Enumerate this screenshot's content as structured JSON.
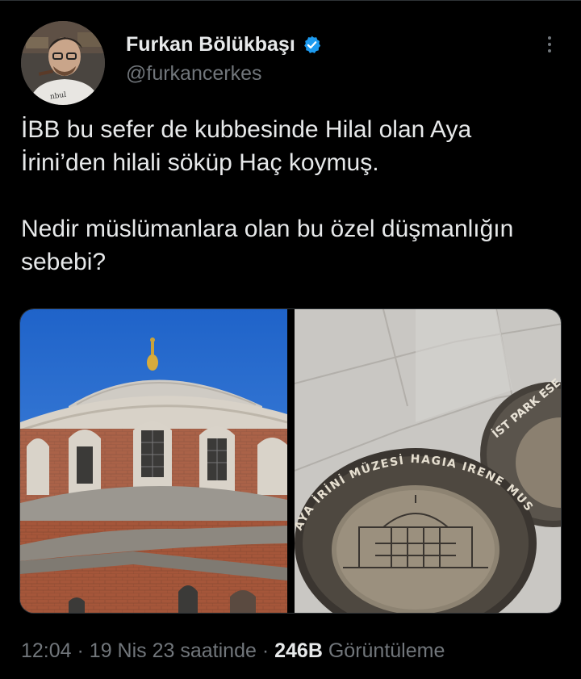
{
  "author": {
    "name": "Furkan Bölükbaşı",
    "handle": "@furkancerkes",
    "verified": true
  },
  "tweet": {
    "text": "İBB bu sefer de kubbesinde Hilal olan Aya İrini’den hilali söküp Haç koymuş.\n\nNedir müslümanlara olan bu özel düşmanlığın sebebi?"
  },
  "media": {
    "count": 2,
    "photo_left": "church-dome-photo",
    "photo_right": "museum-plaque-photo",
    "plaque_text_outer": "AYA İRİNİ MÜZESİ HAGIA IRENE MUSEUM",
    "plaque2_text": "İST PARK ESE"
  },
  "meta": {
    "time": "12:04",
    "separator": "·",
    "date": "19 Nis 23 saatinde",
    "views_count": "246B",
    "views_label": "Görüntüleme"
  },
  "colors": {
    "background": "#000000",
    "text": "#e7e9ea",
    "secondary": "#71767b",
    "verified": "#1d9bf0"
  }
}
